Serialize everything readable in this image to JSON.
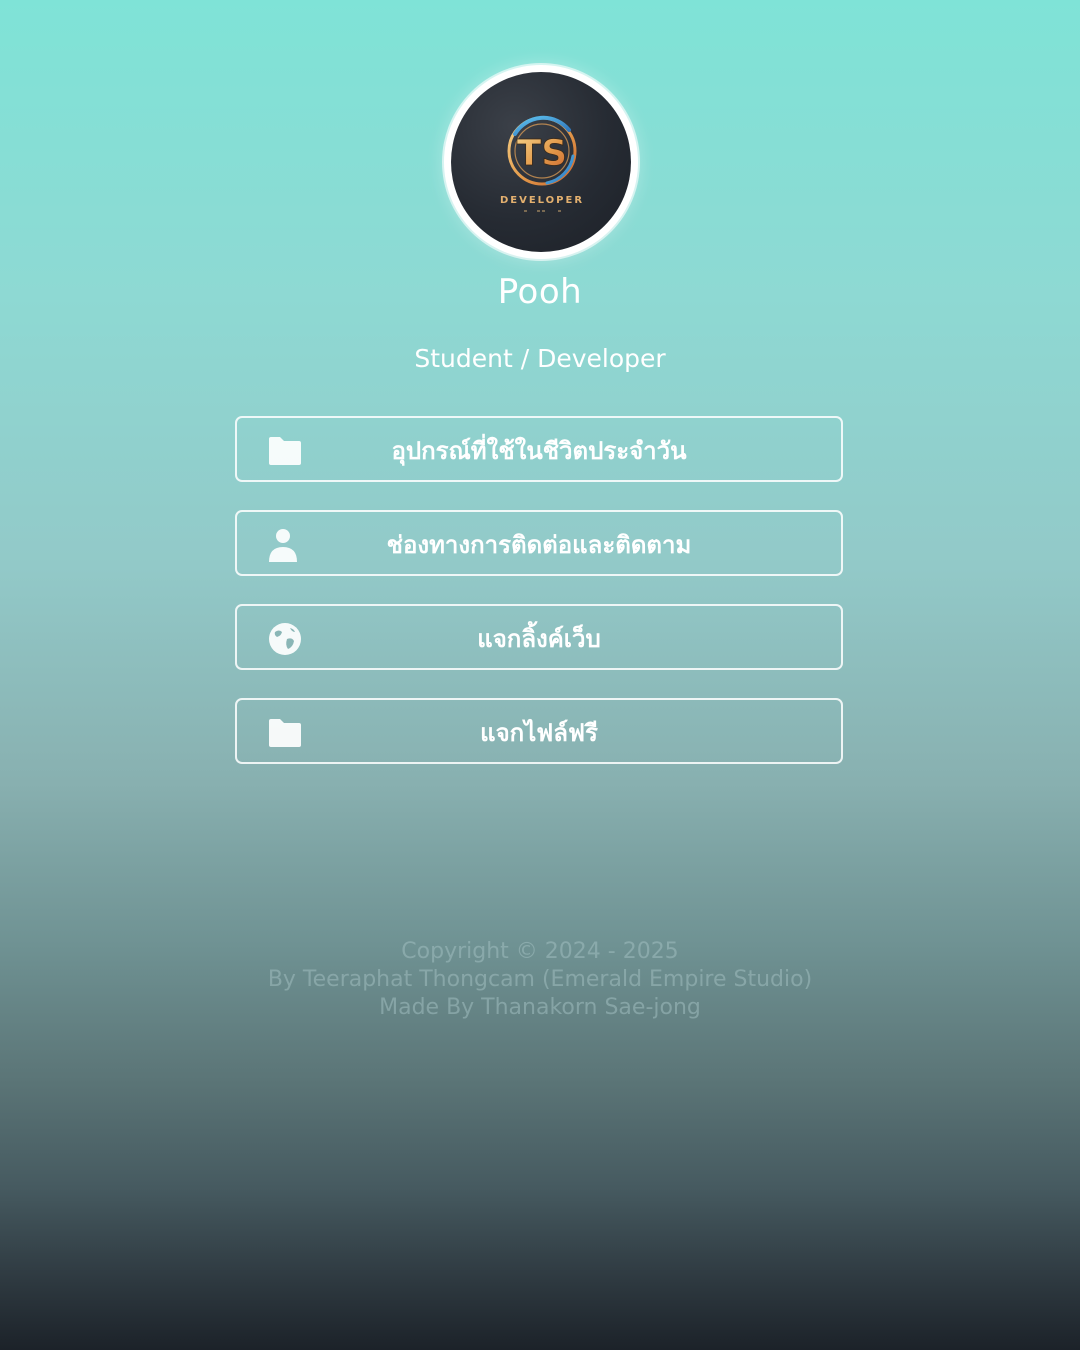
{
  "profile": {
    "name": "Pooh",
    "role": "Student / Developer",
    "avatar_logo_text": "TS",
    "avatar_logo_caption": "DEVELOPER"
  },
  "links": [
    {
      "label": "อุปกรณ์ที่ใช้ในชีวิตประจำวัน",
      "icon": "folder-icon"
    },
    {
      "label": "ช่องทางการติดต่อและติดตาม",
      "icon": "user-icon"
    },
    {
      "label": "แจกลิ้งค์เว็บ",
      "icon": "globe-icon"
    },
    {
      "label": "แจกไฟล์ฟรี",
      "icon": "folder-icon"
    }
  ],
  "footer": {
    "copyright": "Copyright © 2024 - 2025",
    "by": "By Teeraphat Thongcam (Emerald Empire Studio)",
    "made_by": "Made By Thanakorn Sae-jong"
  },
  "colors": {
    "gradient_top": "#7fe3d7",
    "gradient_bottom": "#1c2229",
    "text": "#ffffff",
    "button_border": "#ffffff"
  }
}
